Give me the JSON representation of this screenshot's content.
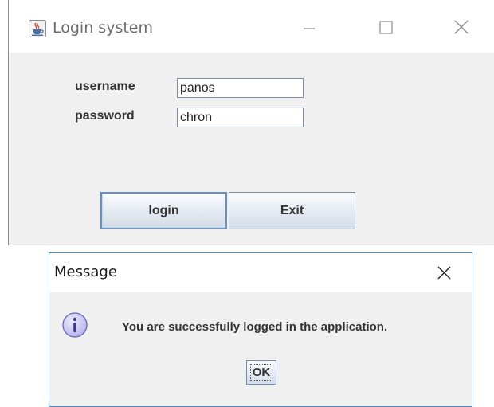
{
  "login_window": {
    "title": "Login system",
    "icon": "java-cup-icon",
    "controls": [
      "minimize",
      "maximize",
      "close"
    ],
    "form": {
      "username_label": "username",
      "username_value": "panos",
      "password_label": "password",
      "password_value": "chron"
    },
    "buttons": {
      "login_label": "login",
      "exit_label": "Exit"
    }
  },
  "message_dialog": {
    "title": "Message",
    "icon": "info-icon",
    "message": "You are successfully logged in the application.",
    "ok_label": "OK"
  },
  "colors": {
    "window_bg": "#f0f0f0",
    "titlebar_bg": "#ffffff",
    "dialog_border": "#4a88c7",
    "focused_button_border": "#6b8fbd",
    "info_icon_fill": "#c9c6f2"
  }
}
